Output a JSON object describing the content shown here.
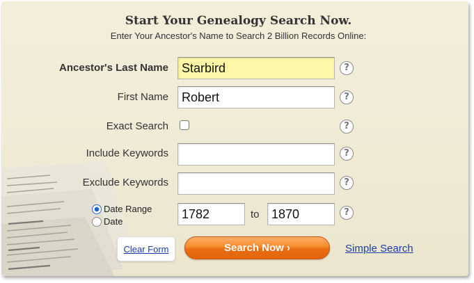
{
  "header": {
    "title": "Start Your Genealogy Search Now.",
    "subtitle": "Enter Your Ancestor's Name to Search 2 Billion Records Online:"
  },
  "form": {
    "last_name": {
      "label": "Ancestor's Last Name",
      "value": "Starbird"
    },
    "first_name": {
      "label": "First Name",
      "value": "Robert"
    },
    "exact_search": {
      "label": "Exact Search",
      "checked": false
    },
    "include_keywords": {
      "label": "Include Keywords",
      "value": ""
    },
    "exclude_keywords": {
      "label": "Exclude Keywords",
      "value": ""
    },
    "date_mode": {
      "options": [
        "Date Range",
        "Date"
      ],
      "selected": "Date Range"
    },
    "date_from": {
      "value": "1782"
    },
    "to_label": "to",
    "date_to": {
      "value": "1870"
    },
    "help_glyph": "?"
  },
  "actions": {
    "clear_label": "Clear Form",
    "search_label": "Search Now ›",
    "simple_search_label": "Simple Search"
  },
  "colors": {
    "background": "#f1ecd7",
    "highlight_field": "#fbf7a6",
    "search_button": "#f58a2d",
    "link": "#1a3ea6"
  },
  "icons": [
    "help-icon",
    "chevron-right-icon",
    "newspaper-stack-image"
  ]
}
